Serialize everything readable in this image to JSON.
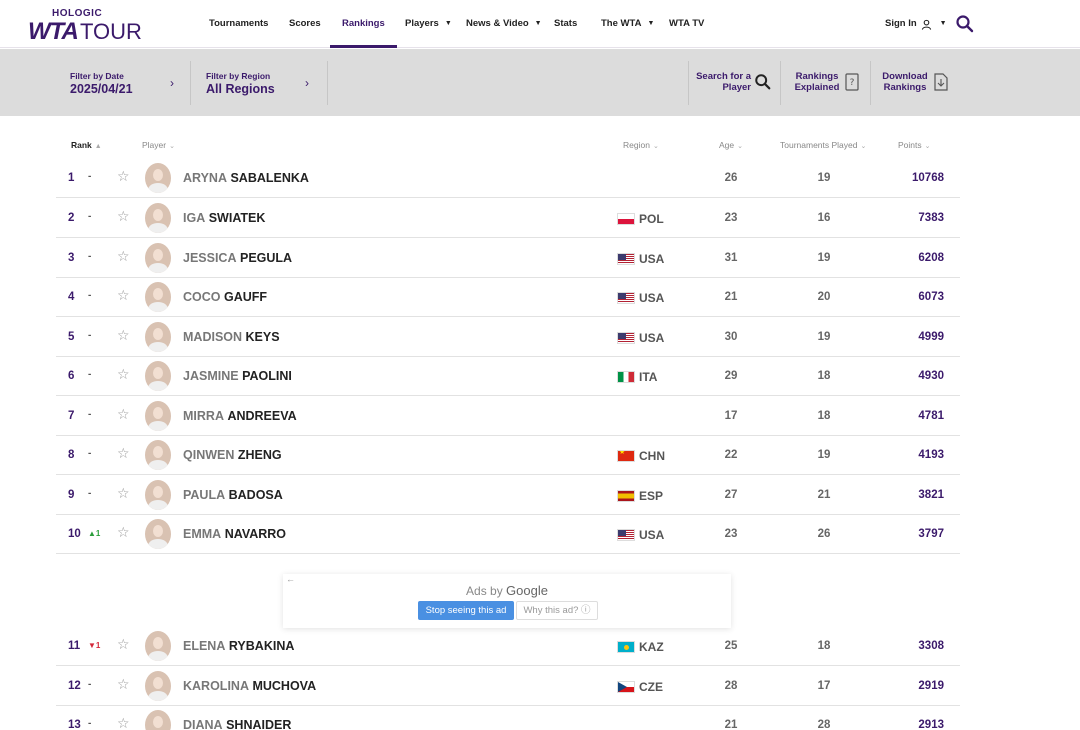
{
  "header": {
    "logo_sponsor": "HOLOGIC",
    "logo_wta": "WTA",
    "logo_tour": "TOUR",
    "nav": [
      {
        "label": "Tournaments"
      },
      {
        "label": "Scores"
      },
      {
        "label": "Rankings"
      },
      {
        "label": "Players"
      },
      {
        "label": "News & Video"
      },
      {
        "label": "Stats"
      },
      {
        "label": "The WTA"
      },
      {
        "label": "WTA TV"
      }
    ],
    "signin_label": "Sign In"
  },
  "filters": {
    "date_label": "Filter by Date",
    "date_value": "2025/04/21",
    "region_label": "Filter by Region",
    "region_value": "All Regions",
    "search_line1": "Search for a",
    "search_line2": "Player",
    "explained_line1": "Rankings",
    "explained_line2": "Explained",
    "download_line1": "Download",
    "download_line2": "Rankings"
  },
  "columns": {
    "rank": "Rank",
    "player": "Player",
    "region": "Region",
    "age": "Age",
    "tournaments": "Tournaments Played",
    "points": "Points"
  },
  "rows": [
    {
      "rank": "1",
      "move": "-",
      "first": "ARYNA",
      "last": "SABALENKA",
      "region": "",
      "age": "26",
      "played": "19",
      "points": "10768"
    },
    {
      "rank": "2",
      "move": "-",
      "first": "IGA",
      "last": "SWIATEK",
      "region": "POL",
      "age": "23",
      "played": "16",
      "points": "7383"
    },
    {
      "rank": "3",
      "move": "-",
      "first": "JESSICA",
      "last": "PEGULA",
      "region": "USA",
      "age": "31",
      "played": "19",
      "points": "6208"
    },
    {
      "rank": "4",
      "move": "-",
      "first": "COCO",
      "last": "GAUFF",
      "region": "USA",
      "age": "21",
      "played": "20",
      "points": "6073"
    },
    {
      "rank": "5",
      "move": "-",
      "first": "MADISON",
      "last": "KEYS",
      "region": "USA",
      "age": "30",
      "played": "19",
      "points": "4999"
    },
    {
      "rank": "6",
      "move": "-",
      "first": "JASMINE",
      "last": "PAOLINI",
      "region": "ITA",
      "age": "29",
      "played": "18",
      "points": "4930"
    },
    {
      "rank": "7",
      "move": "-",
      "first": "MIRRA",
      "last": "ANDREEVA",
      "region": "",
      "age": "17",
      "played": "18",
      "points": "4781"
    },
    {
      "rank": "8",
      "move": "-",
      "first": "QINWEN",
      "last": "ZHENG",
      "region": "CHN",
      "age": "22",
      "played": "19",
      "points": "4193"
    },
    {
      "rank": "9",
      "move": "-",
      "first": "PAULA",
      "last": "BADOSA",
      "region": "ESP",
      "age": "27",
      "played": "21",
      "points": "3821"
    },
    {
      "rank": "10",
      "move": "▲1",
      "first": "EMMA",
      "last": "NAVARRO",
      "region": "USA",
      "age": "23",
      "played": "26",
      "points": "3797"
    },
    {
      "rank": "11",
      "move": "▼1",
      "first": "ELENA",
      "last": "RYBAKINA",
      "region": "KAZ",
      "age": "25",
      "played": "18",
      "points": "3308"
    },
    {
      "rank": "12",
      "move": "-",
      "first": "KAROLINA",
      "last": "MUCHOVA",
      "region": "CZE",
      "age": "28",
      "played": "17",
      "points": "2919"
    },
    {
      "rank": "13",
      "move": "-",
      "first": "DIANA",
      "last": "SHNAIDER",
      "region": "",
      "age": "21",
      "played": "28",
      "points": "2913"
    }
  ],
  "ad": {
    "back": "←",
    "ads_by": "Ads by",
    "brand": "Google",
    "stop": "Stop seeing this ad",
    "why": "Why this ad? ⓘ"
  }
}
